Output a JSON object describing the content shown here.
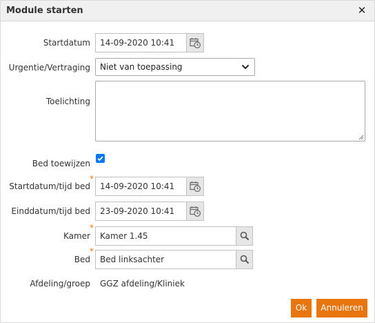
{
  "dialog": {
    "title": "Module starten",
    "close_glyph": "✕"
  },
  "form": {
    "startdatum": {
      "label": "Startdatum",
      "value": "14-09-2020 10:41"
    },
    "urgentie": {
      "label": "Urgentie/Vertraging",
      "value": "Niet van toepassing"
    },
    "toelichting": {
      "label": "Toelichting",
      "value": ""
    },
    "bed_toewijzen": {
      "label": "Bed toewijzen",
      "checked": true
    },
    "startdatum_bed": {
      "label": "Startdatum/tijd bed",
      "value": "14-09-2020 10:41",
      "required_mark": "*"
    },
    "einddatum_bed": {
      "label": "Einddatum/tijd bed",
      "value": "23-09-2020 10:41"
    },
    "kamer": {
      "label": "Kamer",
      "value": "Kamer 1.45",
      "required_mark": "*"
    },
    "bed": {
      "label": "Bed",
      "value": "Bed linksachter",
      "required_mark": "*"
    },
    "afdeling": {
      "label": "Afdeling/groep",
      "value": "GGZ afdeling/Kliniek"
    }
  },
  "buttons": {
    "ok": "Ok",
    "cancel": "Annuleren"
  },
  "colors": {
    "accent": "#e8760d",
    "checkbox": "#0075ff"
  },
  "icons": {
    "calendar": "calendar-clock-icon",
    "search": "search-icon",
    "dropdown": "chevron-down-icon",
    "close": "close-icon"
  }
}
